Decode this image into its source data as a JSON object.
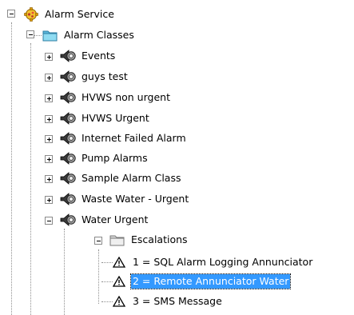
{
  "tree": {
    "root": {
      "label": "Alarm Service",
      "icon": "gear-service-icon"
    },
    "alarm_classes": {
      "label": "Alarm Classes",
      "icon": "open-folder-icon"
    },
    "classes": [
      {
        "label": "Events",
        "icon": "alarm-speaker-icon"
      },
      {
        "label": "guys test",
        "icon": "alarm-speaker-icon"
      },
      {
        "label": "HVWS non urgent",
        "icon": "alarm-speaker-icon"
      },
      {
        "label": "HVWS Urgent",
        "icon": "alarm-speaker-icon"
      },
      {
        "label": "Internet Failed Alarm",
        "icon": "alarm-speaker-icon"
      },
      {
        "label": "Pump Alarms",
        "icon": "alarm-speaker-icon"
      },
      {
        "label": "Sample Alarm Class",
        "icon": "alarm-speaker-icon"
      },
      {
        "label": "Waste Water - Urgent",
        "icon": "alarm-speaker-icon"
      },
      {
        "label": "Water Urgent",
        "icon": "alarm-speaker-icon"
      }
    ],
    "escalations": {
      "label": "Escalations",
      "icon": "open-folder-icon"
    },
    "escalation_items": [
      {
        "label": "1 = SQL Alarm Logging Annunciator",
        "icon": "warning-triangle-icon"
      },
      {
        "label": "2 = Remote Annunciator Water",
        "icon": "warning-triangle-icon",
        "selected": true
      },
      {
        "label": "3 = SMS Message",
        "icon": "warning-triangle-icon"
      }
    ]
  },
  "colors": {
    "selection": "#3399ff",
    "folder": "#6fc7e8",
    "gear": "#e0a400"
  }
}
